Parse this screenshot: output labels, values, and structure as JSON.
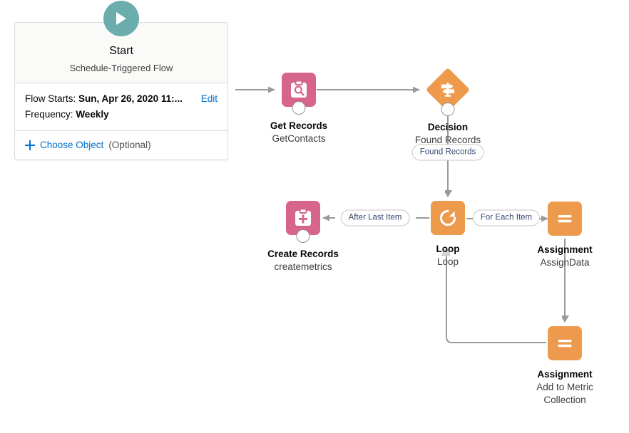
{
  "app": {
    "name": "Flow Builder Canvas"
  },
  "start": {
    "icon": "play-icon",
    "title": "Start",
    "subtitle": "Schedule-Triggered Flow",
    "flow_starts_label": "Flow Starts:",
    "flow_starts_value": "Sun, Apr 26, 2020 11:...",
    "frequency_label": "Frequency:",
    "frequency_value": "Weekly",
    "edit_label": "Edit",
    "choose_object_label": "Choose Object",
    "choose_object_optional": "(Optional)",
    "accent_color": "#6BADAD"
  },
  "nodes": [
    {
      "id": "get-records",
      "type": "Get Records",
      "icon": "clipboard-search-icon",
      "label": "Get Records",
      "name": "GetContacts",
      "shape": "square",
      "color": "#D76489"
    },
    {
      "id": "decision",
      "type": "Decision",
      "icon": "signpost-icon",
      "label": "Decision",
      "name": "Found Records",
      "shape": "diamond",
      "color": "#EE9A4D"
    },
    {
      "id": "loop",
      "type": "Loop",
      "icon": "circular-arrow-icon",
      "label": "Loop",
      "name": "Loop",
      "shape": "square",
      "color": "#EE9A4D"
    },
    {
      "id": "create-records",
      "type": "Create Records",
      "icon": "clipboard-plus-icon",
      "label": "Create Records",
      "name": "createmetrics",
      "shape": "square",
      "color": "#D76489"
    },
    {
      "id": "assignment-1",
      "type": "Assignment",
      "icon": "equals-icon",
      "label": "Assignment",
      "name": "AssignData",
      "shape": "square",
      "color": "#EE9A4D"
    },
    {
      "id": "assignment-2",
      "type": "Assignment",
      "icon": "equals-icon",
      "label": "Assignment",
      "name_line1": "Add to Metric",
      "name_line2": "Collection",
      "shape": "square",
      "color": "#EE9A4D"
    }
  ],
  "connector_labels": [
    {
      "id": "found-records",
      "text": "Found Records"
    },
    {
      "id": "after-last-item",
      "text": "After Last Item"
    },
    {
      "id": "for-each-item",
      "text": "For Each Item"
    }
  ],
  "colors": {
    "connector": "#9a9a9a",
    "pink": "#D76489",
    "orange": "#EE9A4D",
    "teal": "#6BADAD",
    "link": "#0070d2"
  }
}
